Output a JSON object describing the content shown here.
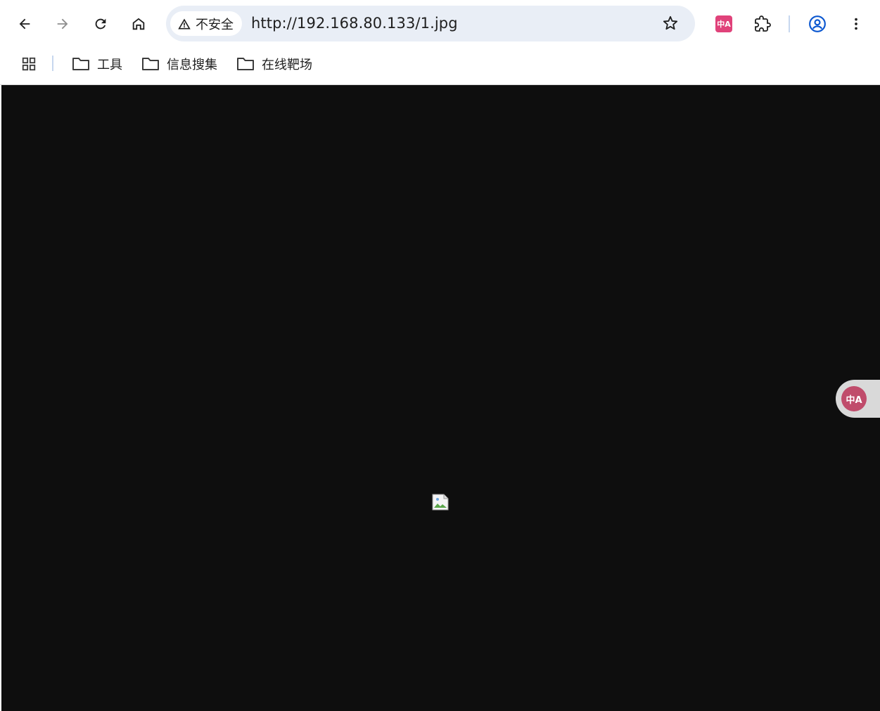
{
  "toolbar": {
    "back_icon": "arrow-left-icon",
    "forward_icon": "arrow-right-icon",
    "reload_icon": "reload-icon",
    "home_icon": "home-icon",
    "security_icon": "warning-triangle-icon",
    "security_label": "不安全",
    "url": "http://192.168.80.133/1.jpg",
    "bookmark_icon": "star-icon",
    "translate_extension_icon": "translate-extension-icon",
    "translate_extension_badge": "中A",
    "extensions_icon": "puzzle-icon",
    "profile_icon": "profile-icon",
    "menu_icon": "more-vert-icon"
  },
  "bookmarks_bar": {
    "apps_icon": "apps-grid-icon",
    "items": [
      {
        "label": "工具",
        "icon": "folder-icon"
      },
      {
        "label": "信息搜集",
        "icon": "folder-icon"
      },
      {
        "label": "在线靶场",
        "icon": "folder-icon"
      }
    ]
  },
  "page": {
    "background": "#0e0e0e",
    "image_state": "broken-image-icon"
  },
  "floating_translate": {
    "label": "中A",
    "color": "#c04c6b"
  },
  "colors": {
    "omnibox_bg": "#e9eef6",
    "accent": "#0b57d0",
    "extension_badge": "#e0427a"
  }
}
